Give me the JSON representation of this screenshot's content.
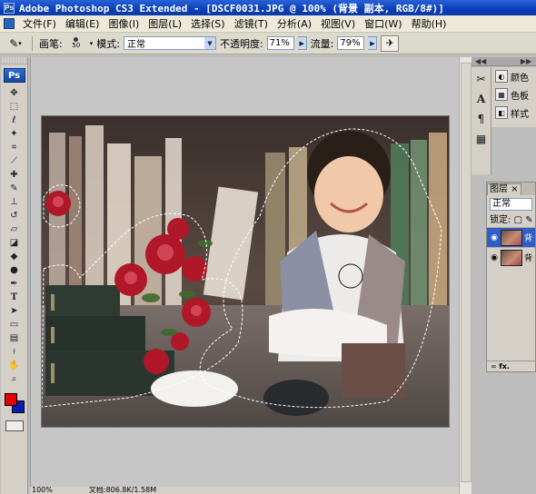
{
  "window": {
    "title": "Adobe Photoshop CS3 Extended - [DSCF0031.JPG @ 100% (背景 副本, RGB/8#)]"
  },
  "menu": [
    "文件(F)",
    "编辑(E)",
    "图像(I)",
    "图层(L)",
    "选择(S)",
    "滤镜(T)",
    "分析(A)",
    "视图(V)",
    "窗口(W)",
    "帮助(H)"
  ],
  "options": {
    "brush_label": "画笔:",
    "brush_size": "50",
    "mode_label": "模式:",
    "mode_value": "正常",
    "opacity_label": "不透明度:",
    "opacity_value": "71%",
    "flow_label": "流量:",
    "flow_value": "79%"
  },
  "toolbox": {
    "logo": "Ps",
    "foreground_color": "#e50000",
    "background_color": "#0a1bb5"
  },
  "panels": {
    "dock_arrows_left": "◀◀",
    "dock_arrows_right": "▶▶",
    "items": [
      {
        "label": "颜色",
        "icon": "palette-icon"
      },
      {
        "label": "色板",
        "icon": "swatches-icon"
      },
      {
        "label": "样式",
        "icon": "styles-icon"
      }
    ],
    "layers": {
      "tab_label": "图层",
      "tab_close": "×",
      "blend_mode": "正常",
      "lock_label": "锁定:",
      "rows": [
        {
          "name": "背景 副本",
          "selected": true
        },
        {
          "name": "背景",
          "selected": false
        }
      ],
      "footer": "fx."
    }
  },
  "status": {
    "zoom": "100%",
    "doc_info": "文档:806.8K/1.58M"
  },
  "colors": {
    "titlebar": "#0a3fb8",
    "accent": "#2f5fc6"
  }
}
